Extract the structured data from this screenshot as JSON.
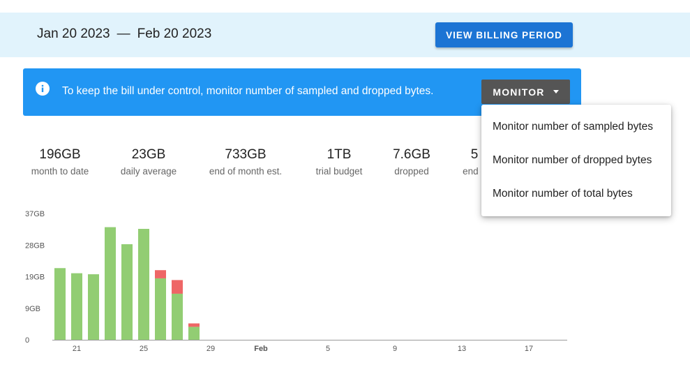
{
  "billing": {
    "start_date": "Jan 20 2023",
    "separator": "—",
    "end_date": "Feb 20 2023",
    "view_button": "VIEW BILLING PERIOD"
  },
  "alert": {
    "icon": "info-icon",
    "text": "To keep the bill under control, monitor number of sampled and dropped bytes.",
    "monitor_button": "MONITOR",
    "background": "#2196f3"
  },
  "stats": [
    {
      "value": "196GB",
      "label": "month to date"
    },
    {
      "value": "23GB",
      "label": "daily average"
    },
    {
      "value": "733GB",
      "label": "end of month est."
    },
    {
      "value": "1TB",
      "label": "trial budget"
    },
    {
      "value": "7.6GB",
      "label": "dropped"
    },
    {
      "value": "5",
      "label": "end o"
    }
  ],
  "menu": {
    "items": [
      "Monitor number of sampled bytes",
      "Monitor number of dropped bytes",
      "Monitor number of total bytes"
    ]
  },
  "chart_data": {
    "type": "bar",
    "stacked": true,
    "colors": {
      "sampled": "#92cd73",
      "dropped": "#ee6666"
    },
    "y_ticks": [
      "0",
      "9GB",
      "19GB",
      "28GB",
      "37GB"
    ],
    "ylim": [
      0,
      37
    ],
    "x_ticks": [
      "21",
      "25",
      "29",
      "Feb",
      "5",
      "9",
      "13",
      "17"
    ],
    "categories": [
      "Jan 20",
      "Jan 21",
      "Jan 22",
      "Jan 23",
      "Jan 24",
      "Jan 25",
      "Jan 26",
      "Jan 27",
      "Jan 28",
      "Jan 29",
      "Jan 30",
      "Jan 31",
      "Feb 1",
      "Feb 2",
      "Feb 3",
      "Feb 4",
      "Feb 5",
      "Feb 6",
      "Feb 7",
      "Feb 8",
      "Feb 9",
      "Feb 10",
      "Feb 11",
      "Feb 12",
      "Feb 13",
      "Feb 14",
      "Feb 15",
      "Feb 16",
      "Feb 17",
      "Feb 18",
      "Feb 19"
    ],
    "series": [
      {
        "key": "sampled",
        "values": [
          21,
          19.5,
          19.2,
          33,
          28,
          32.5,
          18,
          13.5,
          3.8,
          0,
          0,
          0,
          0,
          0,
          0,
          0,
          0,
          0,
          0,
          0,
          0,
          0,
          0,
          0,
          0,
          0,
          0,
          0,
          0,
          0,
          0
        ]
      },
      {
        "key": "dropped",
        "values": [
          0,
          0,
          0,
          0,
          0,
          0,
          2.4,
          4.0,
          1.0,
          0,
          0,
          0,
          0,
          0,
          0,
          0,
          0,
          0,
          0,
          0,
          0,
          0,
          0,
          0,
          0,
          0,
          0,
          0,
          0,
          0,
          0
        ]
      }
    ]
  }
}
